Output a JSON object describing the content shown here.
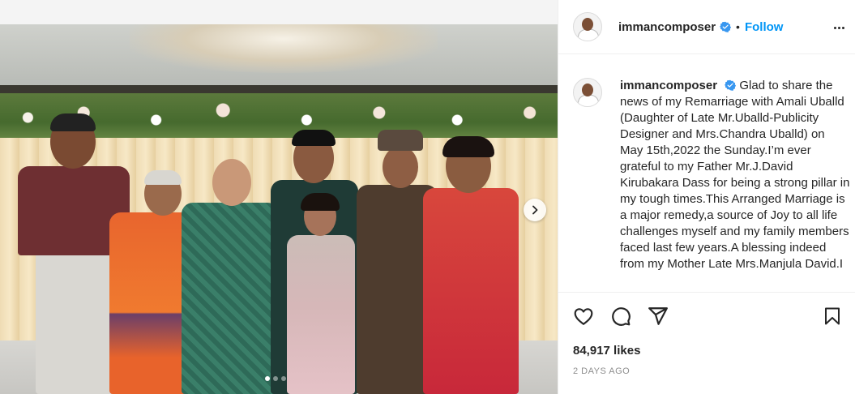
{
  "post": {
    "username": "immancomposer",
    "follow_label": "Follow",
    "bullet": "•",
    "caption": "Glad to share the news of my Remarriage with Amali Uballd (Daughter of Late Mr.Uballd-Publicity Designer and Mrs.Chandra Uballd) on May 15th,2022 the Sunday.I’m ever grateful to my Father Mr.J.David Kirubakara Dass for being a strong pillar in my tough times.This Arranged Marriage is a major remedy,a source of Joy to all life challenges myself and my family members faced last few years.A blessing indeed from my Mother Late Mrs.Manjula David.I",
    "likes": "84,917 likes",
    "time_ago": "2 DAYS AGO",
    "carousel": {
      "current": 1,
      "total": 3
    }
  },
  "icons": {
    "verified": "verified-badge-icon",
    "more": "more-options-icon",
    "like": "heart-icon",
    "comment": "comment-bubble-icon",
    "share": "paper-plane-icon",
    "save": "bookmark-icon",
    "next": "chevron-right-icon"
  },
  "colors": {
    "link_blue": "#0095f6",
    "verified_blue": "#3897f0",
    "text": "#262626",
    "muted": "#8e8e8e",
    "divider": "#efefef"
  }
}
